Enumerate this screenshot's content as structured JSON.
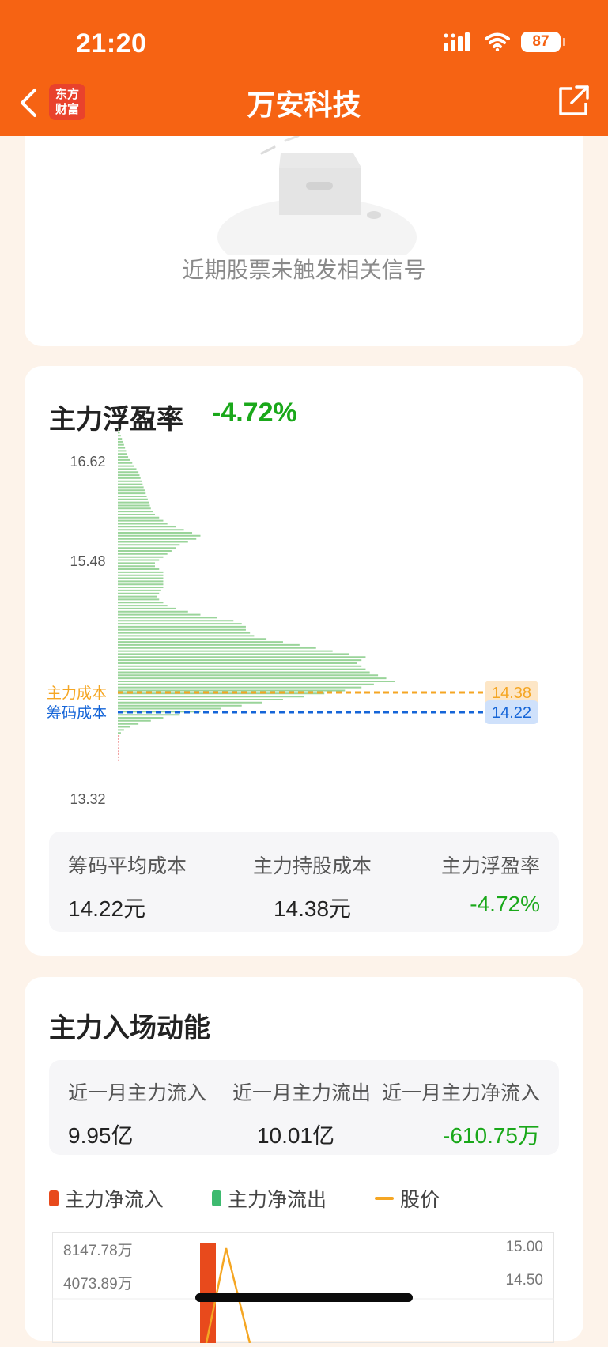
{
  "status_bar": {
    "time": "21:20",
    "battery": "87"
  },
  "header": {
    "logo_line1": "东方",
    "logo_line2": "财富",
    "title": "万安科技"
  },
  "signal_card": {
    "empty_text": "近期股票未触发相关信号"
  },
  "profit_card": {
    "title": "主力浮盈率",
    "rate": "-4.72%",
    "y_labels": [
      "16.62",
      "15.48",
      "13.32"
    ],
    "main_cost_label": "主力成本",
    "main_cost_value": "14.38",
    "chip_cost_label": "筹码成本",
    "chip_cost_value": "14.22",
    "stats": [
      {
        "label": "筹码平均成本",
        "value": "14.22元"
      },
      {
        "label": "主力持股成本",
        "value": "14.38元"
      },
      {
        "label": "主力浮盈率",
        "value": "-4.72%"
      }
    ]
  },
  "momentum_card": {
    "title": "主力入场动能",
    "stats": [
      {
        "label": "近一月主力流入",
        "value": "9.95亿"
      },
      {
        "label": "近一月主力流出",
        "value": "10.01亿"
      },
      {
        "label": "近一月主力净流入",
        "value": "-610.75万"
      }
    ],
    "legend": [
      "主力净流入",
      "主力净流出",
      "股价"
    ],
    "axis_left": [
      "8147.78万",
      "4073.89万"
    ],
    "axis_right": [
      "15.00",
      "14.50"
    ]
  },
  "chart_data": [
    {
      "type": "bar",
      "orientation": "horizontal",
      "title": "主力浮盈率",
      "y_ticks": [
        16.62,
        15.48,
        13.32
      ],
      "ylim": [
        13.32,
        16.62
      ],
      "reference_lines": [
        {
          "name": "主力成本",
          "value": 14.38,
          "color": "#f5a623"
        },
        {
          "name": "筹码成本",
          "value": 14.22,
          "color": "#1565d8"
        }
      ],
      "price_levels": [
        16.6,
        16.57,
        16.54,
        16.51,
        16.48,
        16.45,
        16.42,
        16.39,
        16.36,
        16.33,
        16.3,
        16.27,
        16.24,
        16.21,
        16.18,
        16.15,
        16.12,
        16.09,
        16.06,
        16.03,
        16.0,
        15.97,
        15.94,
        15.91,
        15.88,
        15.85,
        15.82,
        15.79,
        15.76,
        15.73,
        15.7,
        15.67,
        15.64,
        15.61,
        15.58,
        15.55,
        15.52,
        15.49,
        15.46,
        15.43,
        15.4,
        15.37,
        15.34,
        15.31,
        15.28,
        15.25,
        15.22,
        15.19,
        15.16,
        15.13,
        15.1,
        15.07,
        15.04,
        15.01,
        14.98,
        14.95,
        14.92,
        14.89,
        14.86,
        14.83,
        14.8,
        14.77,
        14.74,
        14.71,
        14.68,
        14.65,
        14.62,
        14.59,
        14.56,
        14.53,
        14.5,
        14.47,
        14.44,
        14.41,
        14.38,
        14.35,
        14.32,
        14.29,
        14.26,
        14.23,
        14.2,
        14.17,
        14.14,
        14.11,
        14.08,
        14.05,
        14.02,
        13.99,
        13.96,
        13.93,
        13.9,
        13.87,
        13.84,
        13.81,
        13.78,
        13.75,
        13.72,
        13.69,
        13.66,
        13.63,
        13.6,
        13.57,
        13.54,
        13.51,
        13.48,
        13.45,
        13.42,
        13.39,
        13.36,
        13.33
      ],
      "distribution": [
        0.5,
        1,
        1.5,
        2,
        2.5,
        3,
        3.5,
        4,
        4.5,
        5,
        6,
        7,
        8,
        9,
        10,
        10.5,
        11,
        11.5,
        12,
        12.5,
        13,
        13.5,
        14,
        14.5,
        15,
        15.5,
        16,
        17,
        18,
        20,
        22,
        24,
        28,
        32,
        36,
        40,
        38,
        34,
        30,
        28,
        26,
        24,
        22,
        20,
        18,
        18,
        20,
        22,
        22,
        22,
        22,
        22,
        22,
        21,
        20,
        19,
        20,
        22,
        24,
        28,
        34,
        40,
        48,
        56,
        60,
        62,
        62,
        64,
        66,
        72,
        80,
        88,
        96,
        104,
        112,
        120,
        118,
        116,
        118,
        120,
        122,
        126,
        130,
        134,
        124,
        118,
        110,
        100,
        90,
        80,
        70,
        60,
        50,
        40,
        30,
        22,
        16,
        10,
        6,
        3,
        1.5,
        0.8,
        0.5,
        0.3,
        0.2,
        0.1,
        0.05,
        0.02,
        0.01,
        0.01
      ],
      "distribution_max": 134,
      "colors": {
        "above_price": "#9ad49a",
        "below_price": "#f0a1a1"
      },
      "current_price_split": 13.6
    },
    {
      "type": "bar",
      "title": "",
      "legend": [
        "主力净流入",
        "主力净流出",
        "股价"
      ],
      "left_axis_ticks": [
        "8147.78万",
        "4073.89万"
      ],
      "right_axis_ticks": [
        "15.00",
        "14.50"
      ],
      "ylim_left": [
        0,
        8147.78
      ],
      "ylim_right": [
        14.0,
        15.0
      ],
      "bars": [
        {
          "series": "主力净流入",
          "value": 8147.78,
          "index": 0
        }
      ],
      "price_line": [
        13.9,
        14.75,
        13.9
      ],
      "colors": {
        "inflow": "#e84a1c",
        "outflow": "#3dba6f",
        "price": "#f5a623"
      }
    }
  ]
}
